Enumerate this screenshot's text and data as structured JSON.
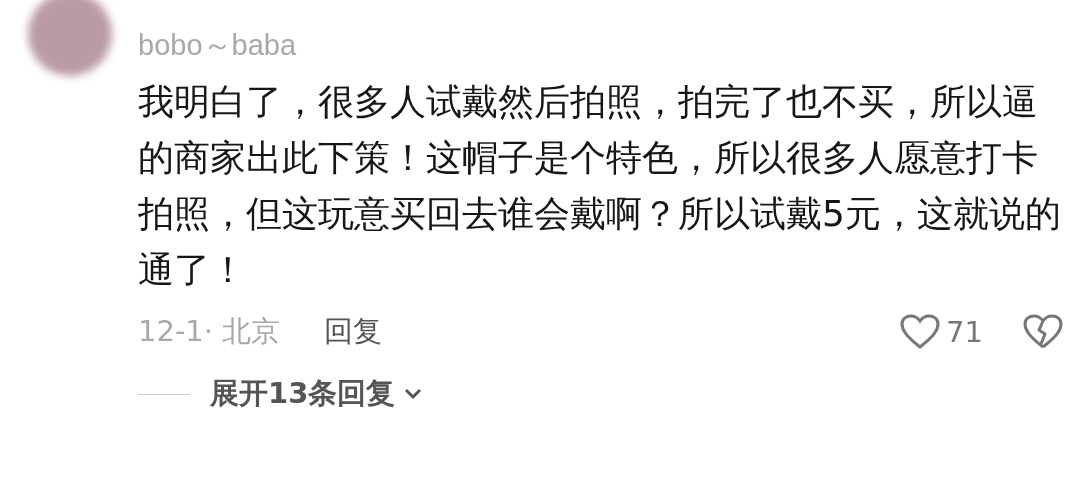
{
  "comment": {
    "username": "bobo～baba",
    "text": "我明白了，很多人试戴然后拍照，拍完了也不买，所以逼的商家出此下策！这帽子是个特色，所以很多人愿意打卡拍照，但这玩意买回去谁会戴啊？所以试戴5元，这就说的通了！",
    "date_location": "12-1· 北京",
    "reply_button": "回复",
    "likes": "71",
    "liked": false,
    "expand_replies": "展开13条回复"
  }
}
